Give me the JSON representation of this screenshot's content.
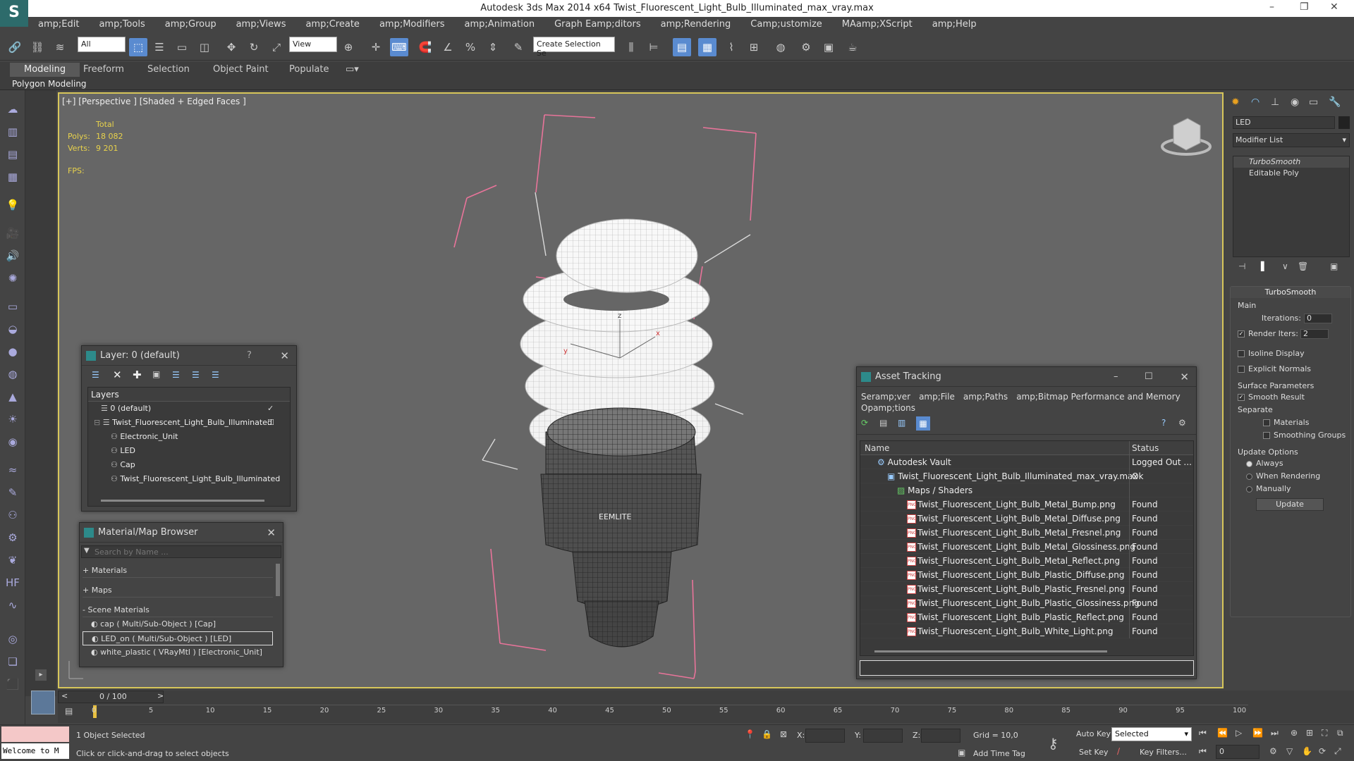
{
  "titlebar": {
    "title": "Autodesk 3ds Max  2014 x64    Twist_Fluorescent_Light_Bulb_Illuminated_max_vray.max",
    "min": "–",
    "max": "❐",
    "close": "✕"
  },
  "menu": [
    "amp;Edit",
    "amp;Tools",
    "amp;Group",
    "amp;Views",
    "amp;Create",
    "amp;Modifiers",
    "amp;Animation",
    "Graph Eamp;ditors",
    "amp;Rendering",
    "Camp;ustomize",
    "MAamp;XScript",
    "amp;Help"
  ],
  "toolbar": {
    "filter": "All",
    "refcoord": "View",
    "selset": "Create Selection Se"
  },
  "ribbon": {
    "tabs": [
      "Modeling",
      "Freeform",
      "Selection",
      "Object Paint",
      "Populate"
    ],
    "sub": "Polygon Modeling"
  },
  "viewport": {
    "label": "[+] [Perspective ] [Shaded + Edged Faces ]",
    "total_label": "Total",
    "polys_label": "Polys:",
    "polys": "18 082",
    "verts_label": "Verts:",
    "verts": "9 201",
    "fps_label": "FPS:",
    "axis_x": "x",
    "axis_y": "y",
    "axis_z": "z",
    "brand": "EEMLITE"
  },
  "layer_win": {
    "title": "Layer: 0 (default)",
    "help": "?",
    "header": "Layers",
    "rows": [
      {
        "label": "0 (default)",
        "indent": 0
      },
      {
        "label": "Twist_Fluorescent_Light_Bulb_Illuminated",
        "indent": 0
      },
      {
        "label": "Electronic_Unit",
        "indent": 1
      },
      {
        "label": "LED",
        "indent": 1
      },
      {
        "label": "Cap",
        "indent": 1
      },
      {
        "label": "Twist_Fluorescent_Light_Bulb_Illuminated",
        "indent": 1
      }
    ]
  },
  "matbrowser": {
    "title": "Material/Map Browser",
    "search_placeholder": "Search by Name ...",
    "sections": [
      "+ Materials",
      "+ Maps",
      "- Scene Materials"
    ],
    "items": [
      "cap  ( Multi/Sub-Object ) [Cap]",
      "LED_on  ( Multi/Sub-Object ) [LED]",
      "white_plastic  ( VRayMtl ) [Electronic_Unit]"
    ]
  },
  "asset": {
    "title": "Asset Tracking",
    "menu": [
      "Seramp;ver",
      "amp;File",
      "amp;Paths",
      "amp;Bitmap Performance and Memory"
    ],
    "menu2": "Opamp;tions",
    "col_name": "Name",
    "col_status": "Status",
    "rows": [
      {
        "name": "Autodesk Vault",
        "status": "Logged Out ...",
        "indent": 0,
        "icon": "vault"
      },
      {
        "name": "Twist_Fluorescent_Light_Bulb_Illuminated_max_vray.max",
        "status": "Ok",
        "indent": 1,
        "icon": "max"
      },
      {
        "name": "Maps / Shaders",
        "status": "",
        "indent": 2,
        "icon": "maps"
      },
      {
        "name": "Twist_Fluorescent_Light_Bulb_Metal_Bump.png",
        "status": "Found",
        "indent": 3,
        "icon": "png"
      },
      {
        "name": "Twist_Fluorescent_Light_Bulb_Metal_Diffuse.png",
        "status": "Found",
        "indent": 3,
        "icon": "png"
      },
      {
        "name": "Twist_Fluorescent_Light_Bulb_Metal_Fresnel.png",
        "status": "Found",
        "indent": 3,
        "icon": "png"
      },
      {
        "name": "Twist_Fluorescent_Light_Bulb_Metal_Glossiness.png",
        "status": "Found",
        "indent": 3,
        "icon": "png"
      },
      {
        "name": "Twist_Fluorescent_Light_Bulb_Metal_Reflect.png",
        "status": "Found",
        "indent": 3,
        "icon": "png"
      },
      {
        "name": "Twist_Fluorescent_Light_Bulb_Plastic_Diffuse.png",
        "status": "Found",
        "indent": 3,
        "icon": "png"
      },
      {
        "name": "Twist_Fluorescent_Light_Bulb_Plastic_Fresnel.png",
        "status": "Found",
        "indent": 3,
        "icon": "png"
      },
      {
        "name": "Twist_Fluorescent_Light_Bulb_Plastic_Glossiness.png",
        "status": "Found",
        "indent": 3,
        "icon": "png"
      },
      {
        "name": "Twist_Fluorescent_Light_Bulb_Plastic_Reflect.png",
        "status": "Found",
        "indent": 3,
        "icon": "png"
      },
      {
        "name": "Twist_Fluorescent_Light_Bulb_White_Light.png",
        "status": "Found",
        "indent": 3,
        "icon": "png"
      }
    ],
    "png_tag": "PNG"
  },
  "cmd": {
    "objname": "LED",
    "modlist": "Modifier List",
    "stack": [
      "TurboSmooth",
      "Editable Poly"
    ],
    "rollout": "TurboSmooth",
    "main": "Main",
    "iterations_label": "Iterations:",
    "iterations": "0",
    "render_iters_label": "Render Iters:",
    "render_iters": "2",
    "isoline": "Isoline Display",
    "explicit": "Explicit Normals",
    "surface": "Surface Parameters",
    "smooth": "Smooth Result",
    "separate": "Separate",
    "materials": "Materials",
    "smoothing": "Smoothing Groups",
    "update_opts": "Update Options",
    "always": "Always",
    "when_render": "When Rendering",
    "manually": "Manually",
    "update_btn": "Update"
  },
  "timeline": {
    "frame": "0 / 100",
    "prev": "<",
    "next": ">",
    "ticks": [
      "0",
      "5",
      "10",
      "15",
      "20",
      "25",
      "30",
      "35",
      "40",
      "45",
      "50",
      "55",
      "60",
      "65",
      "70",
      "75",
      "80",
      "85",
      "90",
      "95",
      "100"
    ]
  },
  "status": {
    "welcome": "Welcome to M",
    "selected": "1 Object Selected",
    "prompt": "Click or click-and-drag to select objects",
    "x_label": "X:",
    "y_label": "Y:",
    "z_label": "Z:",
    "grid": "Grid = 10,0",
    "add_time_tag": "Add Time Tag",
    "autokey": "Auto Key",
    "setkey": "Set Key",
    "selected_dd": "Selected",
    "keyfilters": "Key Filters...",
    "frame_field": "0"
  }
}
